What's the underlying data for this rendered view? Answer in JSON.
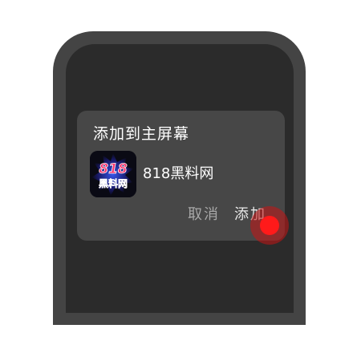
{
  "dialog": {
    "title": "添加到主屏幕",
    "app": {
      "name": "818黑料网",
      "icon": "818-app-logo-icon",
      "logo_text_top": "818",
      "logo_text_bottom": "黑料网"
    },
    "cancel_label": "取消",
    "add_label": "添加"
  },
  "colors": {
    "frame": "#444444",
    "screen": "#2b2b2b",
    "dialog": "#474747",
    "touch": "#ff1a1a"
  }
}
